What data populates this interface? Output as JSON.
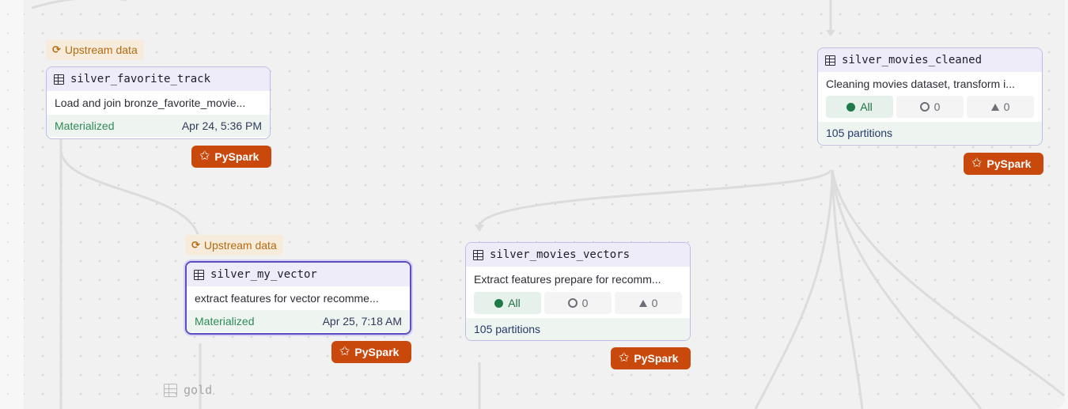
{
  "canvas": {
    "upstream_label": "Upstream data",
    "group_label": "gold",
    "badge_label": "PySpark"
  },
  "nodes": [
    {
      "name": "silver_favorite_track",
      "description": "Load and join bronze_favorite_movie...",
      "status": "Materialized",
      "timestamp": "Apr 24, 5:36 PM"
    },
    {
      "name": "silver_my_vector",
      "description": "extract features for vector recomme...",
      "status": "Materialized",
      "timestamp": "Apr 25, 7:18 AM",
      "selected": true
    },
    {
      "name": "silver_movies_vectors",
      "description": "Extract features prepare for recomm...",
      "filters": {
        "all": "All",
        "missing": "0",
        "failed": "0"
      },
      "partitions": "105 partitions"
    },
    {
      "name": "silver_movies_cleaned",
      "description": "Cleaning movies dataset, transform i...",
      "filters": {
        "all": "All",
        "missing": "0",
        "failed": "0"
      },
      "partitions": "105 partitions"
    }
  ],
  "colors": {
    "badge": "#c9480c",
    "materialized": "#2d8a55",
    "node_border": "#bfbbe6",
    "selected_border": "#5b4fbf"
  }
}
